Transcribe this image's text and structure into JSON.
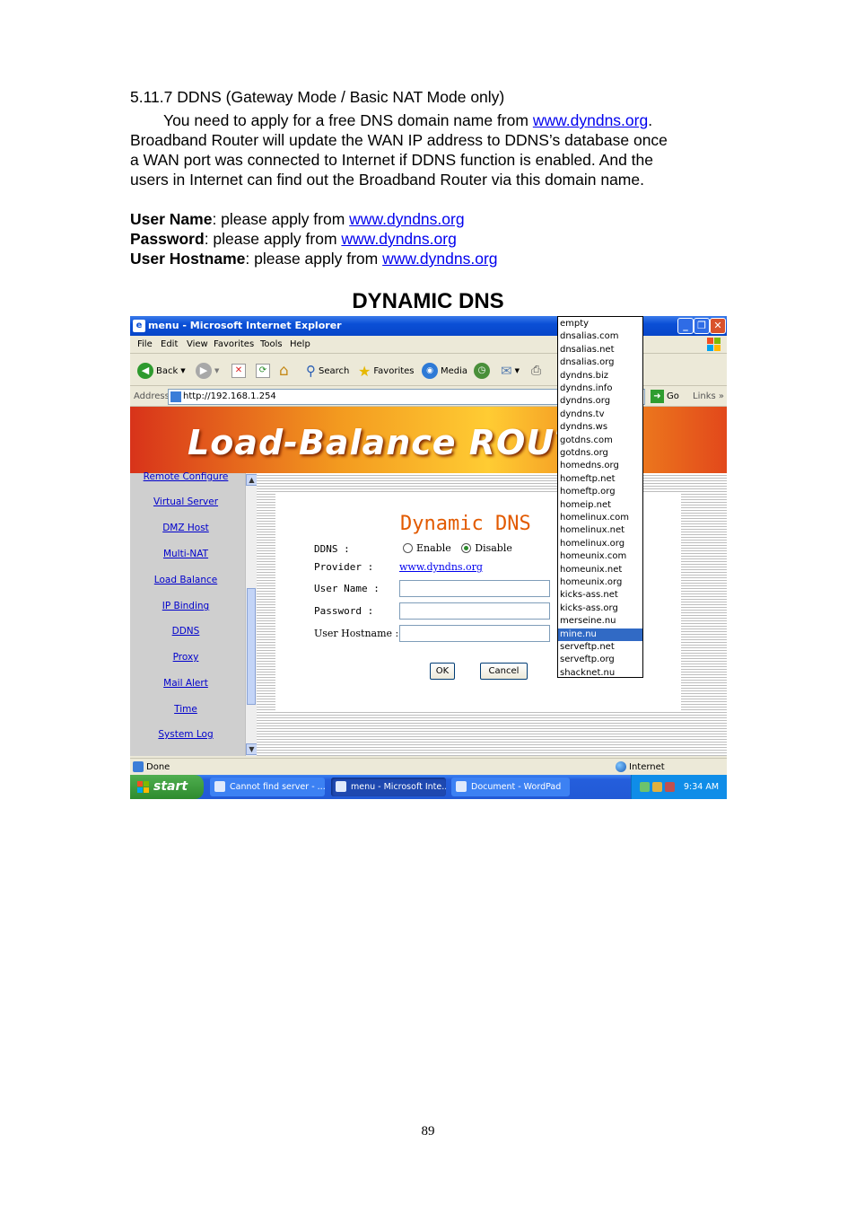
{
  "doc": {
    "section_heading": "5.11.7 DDNS (Gateway Mode / Basic NAT Mode only)",
    "intro_before_link": "You need to apply for a free DNS domain name from ",
    "intro_link": "www.dyndns.org",
    "intro_after_link": ".",
    "intro_line2": "Broadband Router will update the WAN IP address to DDNS’s database once",
    "intro_line3": "a WAN port was connected to Internet if DDNS function is enabled. And the",
    "intro_line4": "users in Internet can find out the Broadband Router via this domain name.",
    "fields": [
      {
        "name": "User Name",
        "text": ": please apply from ",
        "link": "www.dyndns.org"
      },
      {
        "name": "Password",
        "text": ": please apply from ",
        "link": "www.dyndns.org"
      },
      {
        "name": "User Hostname",
        "text": ": please apply from ",
        "link": "www.dyndns.org"
      }
    ],
    "figure_title": "DYNAMIC DNS",
    "page_number": "89"
  },
  "browser": {
    "title": "menu - Microsoft Internet Explorer",
    "menu": [
      "File",
      "Edit",
      "View",
      "Favorites",
      "Tools",
      "Help"
    ],
    "toolbar": {
      "back": "Back",
      "search": "Search",
      "favorites": "Favorites",
      "media": "Media"
    },
    "address_label": "Address",
    "address_value": "http://192.168.1.254",
    "go_label": "Go",
    "links_label": "Links",
    "status_text": "Done",
    "status_zone": "Internet"
  },
  "router": {
    "banner": "Load-Balance ROUTER",
    "nav": [
      "Remote Configure",
      "Virtual Server",
      "DMZ Host",
      "Multi-NAT",
      "Load Balance",
      "IP Binding",
      "DDNS",
      "Proxy",
      "Mail Alert",
      "Time",
      "System Log"
    ],
    "page_title": "Dynamic DNS",
    "ddns_label": "DDNS :",
    "enable_label": "Enable",
    "disable_label": "Disable",
    "ddns_state": "Disable",
    "provider_label": "Provider :",
    "provider_value": "www.dyndns.org",
    "username_label": "User Name :",
    "password_label": "Password :",
    "hostname_label": "User Hostname :",
    "ok_label": "OK",
    "cancel_label": "Cancel"
  },
  "dropdown": {
    "options": [
      "empty",
      "dnsalias.com",
      "dnsalias.net",
      "dnsalias.org",
      "dyndns.biz",
      "dyndns.info",
      "dyndns.org",
      "dyndns.tv",
      "dyndns.ws",
      "gotdns.com",
      "gotdns.org",
      "homedns.org",
      "homeftp.net",
      "homeftp.org",
      "homeip.net",
      "homelinux.com",
      "homelinux.net",
      "homelinux.org",
      "homeunix.com",
      "homeunix.net",
      "homeunix.org",
      "kicks-ass.net",
      "kicks-ass.org",
      "merseine.nu",
      "mine.nu",
      "serveftp.net",
      "serveftp.org",
      "shacknet.nu"
    ],
    "selected": "mine.nu"
  },
  "taskbar": {
    "start": "start",
    "tasks": [
      "Cannot find server - ...",
      "menu - Microsoft Inte...",
      "Document - WordPad"
    ],
    "time": "9:34 AM"
  },
  "colors": {
    "link": "#0000ee",
    "title_orange": "#e25a00",
    "selection": "#316ac5",
    "xp_blue": "#0a4fd6"
  }
}
